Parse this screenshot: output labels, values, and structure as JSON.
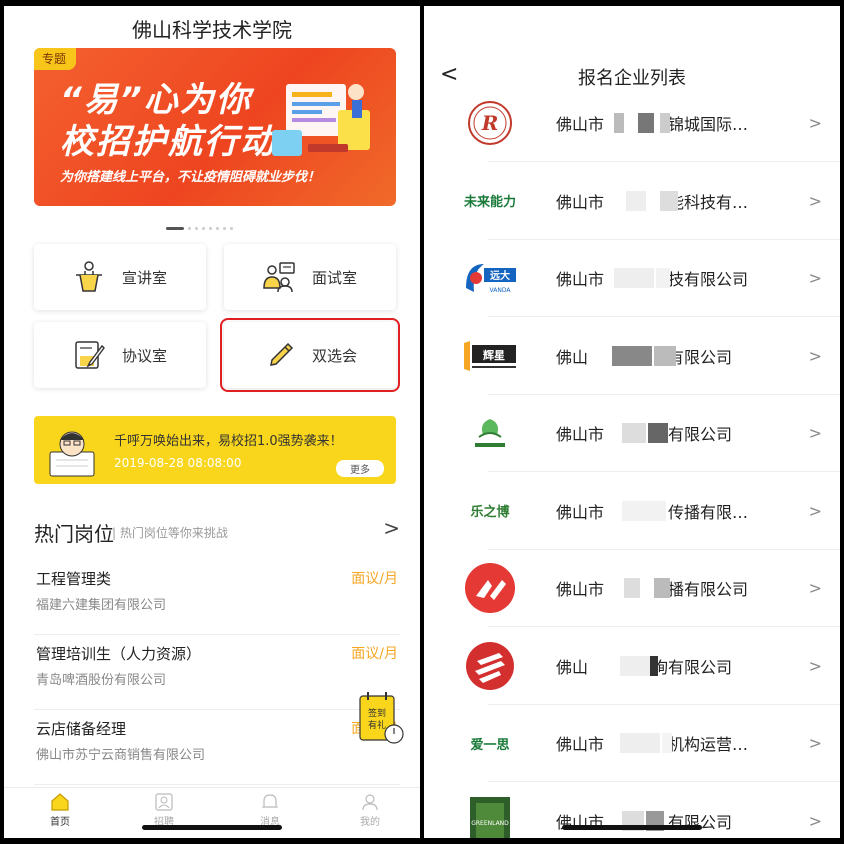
{
  "left": {
    "school_title": "佛山科学技术学院",
    "banner": {
      "tag": "专题",
      "line1": "“易”心为你",
      "line2": "校招护航行动",
      "subtitle": "为你搭建线上平台，不让疫情阻碍就业步伐！"
    },
    "carousel": {
      "count": 8,
      "active": 0
    },
    "rooms": [
      {
        "label": "宣讲室",
        "icon": "lectern-icon"
      },
      {
        "label": "面试室",
        "icon": "interview-icon"
      },
      {
        "label": "协议室",
        "icon": "agreement-icon"
      },
      {
        "label": "双选会",
        "icon": "pen-icon",
        "highlighted": true
      }
    ],
    "news": {
      "title": "千呼万唤始出来，易校招1.0强势袭来！",
      "time": "2019-08-28 08:08:00",
      "more": "更多"
    },
    "hot_jobs": {
      "title": "热门岗位",
      "subtitle": "| 热门岗位等你来挑战",
      "arrow": ">",
      "items": [
        {
          "title": "工程管理类",
          "company": "福建六建集团有限公司",
          "salary": "面议/月"
        },
        {
          "title": "管理培训生（人力资源）",
          "company": "青岛啤酒股份有限公司",
          "salary": "面议/月"
        },
        {
          "title": "云店储备经理",
          "company": "佛山市苏宁云商销售有限公司",
          "salary": "面议/月"
        }
      ]
    },
    "float_badge": {
      "line1": "签到",
      "line2": "有礼"
    },
    "tabbar": [
      {
        "label": "首页",
        "icon": "home-icon",
        "active": true
      },
      {
        "label": "招聘",
        "icon": "recruit-icon",
        "active": false
      },
      {
        "label": "消息",
        "icon": "bell-icon",
        "active": false
      },
      {
        "label": "我的",
        "icon": "user-icon",
        "active": false
      }
    ]
  },
  "right": {
    "back": "<",
    "title": "报名企业列表",
    "chevron": ">",
    "companies": [
      {
        "name": "佛山市　　　　锦城国际…",
        "logo": "round-red-r-logo"
      },
      {
        "name": "佛山市　　　　能科技有…",
        "logo": "text-logo",
        "logo_text": "未来能力",
        "logo_color": "#1a7a3a"
      },
      {
        "name": "佛山市　　　　技有限公司",
        "logo": "blue-swoosh-logo",
        "logo_text": "远大制釉"
      },
      {
        "name": "佛山　　　　　有限公司",
        "logo": "dark-text-logo",
        "logo_text": "辉星家居"
      },
      {
        "name": "佛山市　　　　有限公司",
        "logo": "green-leaf-logo"
      },
      {
        "name": "佛山市　　　　传播有限…",
        "logo": "text-logo",
        "logo_text": "乐之博",
        "logo_color": "#2e7d32"
      },
      {
        "name": "佛山市　　　　播有限公司",
        "logo": "red-circle-x-logo"
      },
      {
        "name": "佛山　　　　询有限公司",
        "logo": "red-circle-stripes-logo"
      },
      {
        "name": "佛山市　　　　机构运营…",
        "logo": "text-logo",
        "logo_text": "爱一思",
        "logo_color": "#1a7a3a"
      },
      {
        "name": "佛山市　　　　有限公司",
        "logo": "greenland-logo",
        "logo_text": "GREENLAND"
      }
    ]
  },
  "colors": {
    "accent_orange": "#f5a623",
    "banner_red": "#ee4520",
    "news_yellow": "#f9d61c",
    "highlight_red": "#e02020"
  }
}
